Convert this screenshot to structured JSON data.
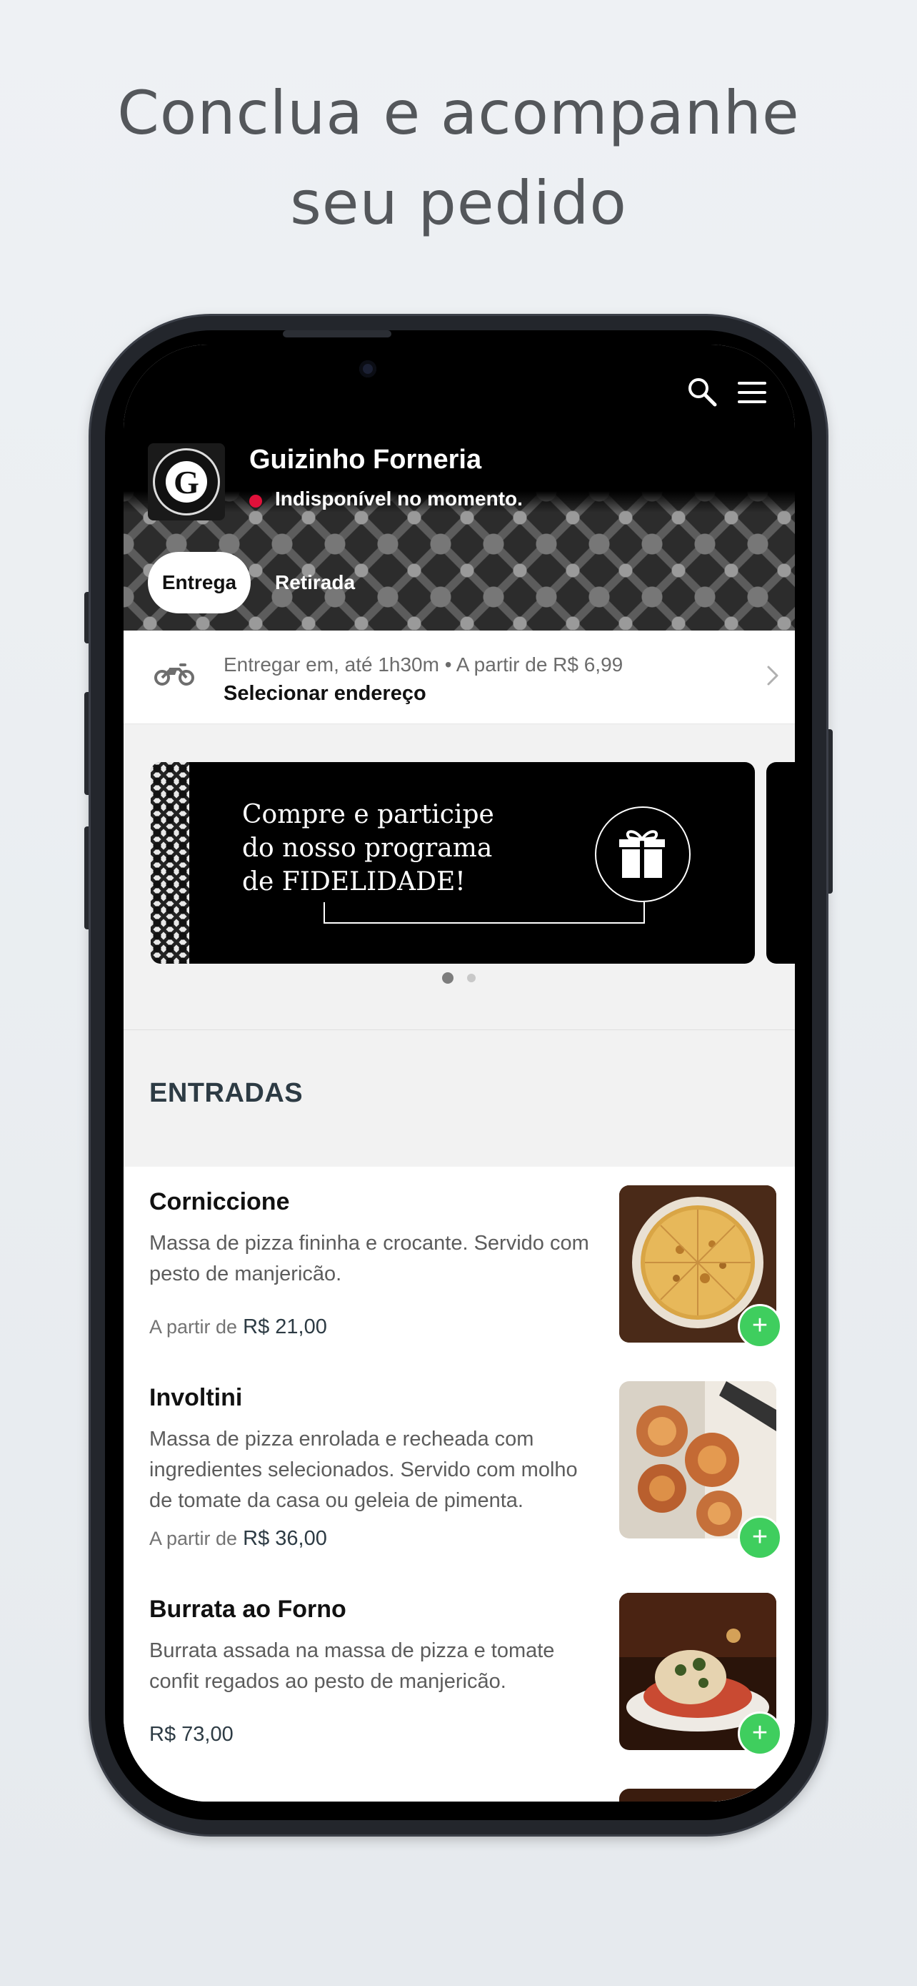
{
  "headline": {
    "line1": "Conclua e acompanhe",
    "line2": "seu pedido"
  },
  "store": {
    "name": "Guizinho Forneria",
    "logo_letter": "G",
    "status": "Indisponível no momento.",
    "status_color": "#e0113a"
  },
  "tabs": [
    {
      "label": "Entrega",
      "active": true
    },
    {
      "label": "Retirada",
      "active": false
    }
  ],
  "delivery": {
    "info": "Entregar em, até 1h30m • A partir de R$ 6,99",
    "address_cta": "Selecionar endereço"
  },
  "banner": {
    "line1": "Compre e participe",
    "line2": "do nosso programa",
    "line3": "de FIDELIDADE!",
    "pages": 2,
    "current_page": 1
  },
  "section": {
    "title": "ENTRADAS"
  },
  "items": [
    {
      "name": "Corniccione",
      "description": "Massa de pizza fininha e crocante. Servido com pesto de manjericão.",
      "price_prefix": "A partir de",
      "price": "R$ 21,00"
    },
    {
      "name": "Involtini",
      "description": "Massa de pizza enrolada e recheada com ingredientes selecionados. Servido com molho de tomate da casa ou geleia de pimenta.",
      "price_prefix": "A partir de",
      "price": "R$ 36,00"
    },
    {
      "name": "Burrata ao Forno",
      "description": "Burrata assada na massa de pizza e tomate confit regados ao pesto de manjericão.",
      "price_prefix": "",
      "price": "R$ 73,00"
    }
  ],
  "colors": {
    "accent_green": "#3fce5e",
    "title_dark": "#2d3b44"
  }
}
